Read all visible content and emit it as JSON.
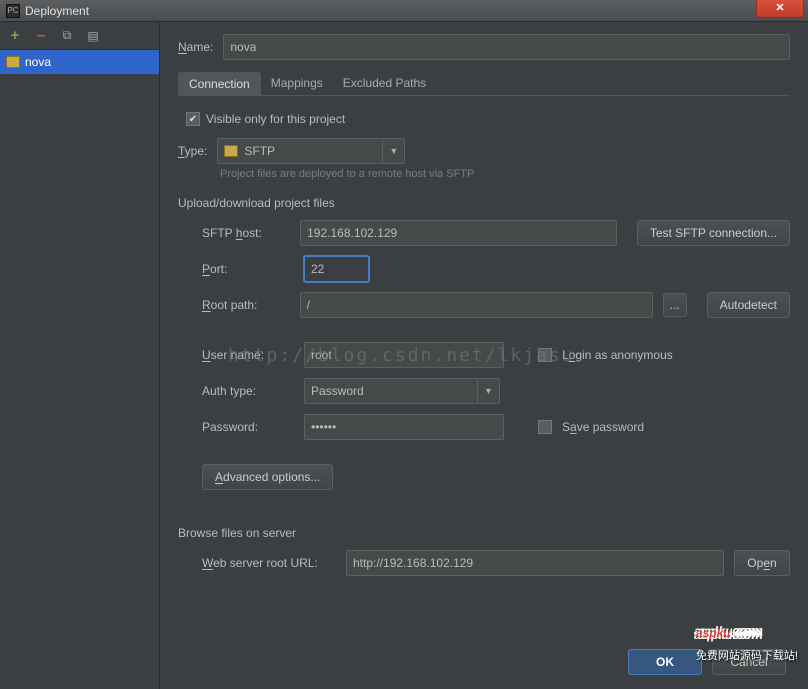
{
  "window": {
    "title": "Deployment",
    "close": "✕"
  },
  "toolbar": {
    "add": "+",
    "remove": "–",
    "copy": "⧉",
    "run": "▤"
  },
  "tree": {
    "item0": "nova"
  },
  "name": {
    "label": "Name:",
    "value": "nova"
  },
  "tabs": [
    "Connection",
    "Mappings",
    "Excluded Paths"
  ],
  "visible_only": {
    "label": "Visible only for this project",
    "checked": true
  },
  "type": {
    "label": "Type:",
    "value": "SFTP",
    "hint": "Project files are deployed to a remote host via SFTP"
  },
  "upload_section": "Upload/download project files",
  "fields": {
    "sftp_host": {
      "label": "SFTP host:",
      "value": "192.168.102.129"
    },
    "test_btn": "Test SFTP connection...",
    "port": {
      "label": "Port:",
      "value": "22"
    },
    "root_path": {
      "label": "Root path:",
      "value": "/"
    },
    "browse_btn": "...",
    "autodetect_btn": "Autodetect",
    "user_name": {
      "label": "User name:",
      "value": "root"
    },
    "login_anon": "Login as anonymous",
    "auth_type": {
      "label": "Auth type:",
      "value": "Password"
    },
    "password": {
      "label": "Password:",
      "value": "••••••"
    },
    "save_pw": "Save password",
    "advanced_btn": "Advanced options..."
  },
  "browse_section": "Browse files on server",
  "web_url": {
    "label": "Web server root URL:",
    "value": "http://192.168.102.129"
  },
  "open_btn": "Open",
  "footer": {
    "ok": "OK",
    "cancel": "Cancel"
  },
  "watermark": "http://blog.csdn.net/lkjasu",
  "aspku": {
    "logo": "aspku",
    "com": ".com",
    "sub": "免费网站源码下载站!"
  }
}
